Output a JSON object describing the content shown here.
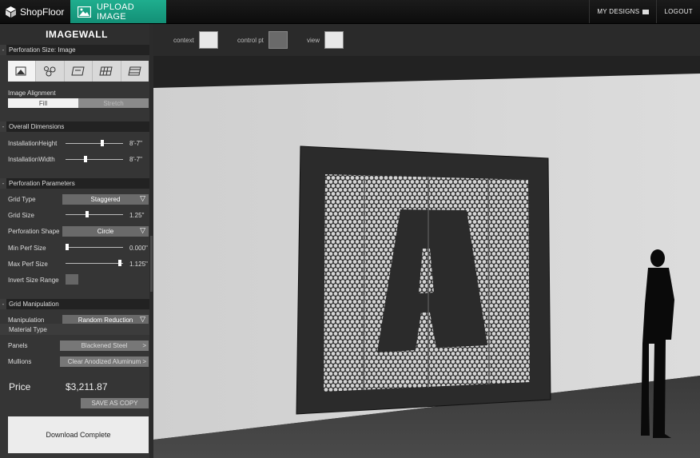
{
  "topbar": {
    "brand": "ShopFloor",
    "upload": "UPLOAD IMAGE",
    "my_designs": "MY DESIGNS",
    "logout": "LOGOUT"
  },
  "panel": {
    "logo": "IMAGEWALL",
    "perforation_size": {
      "title": "Perforation Size: Image",
      "icons": [
        "image-mode-icon",
        "circles-icon",
        "map-icon",
        "grid-map-icon",
        "grid-icon"
      ],
      "alignment_label": "Image Alignment",
      "fill": "Fill",
      "stretch": "Stretch"
    },
    "overall": {
      "title": "Overall Dimensions",
      "height_label": "InstallationHeight",
      "height_value": "8'-7\"",
      "width_label": "InstallationWidth",
      "width_value": "8'-7\""
    },
    "perf_params": {
      "title": "Perforation Parameters",
      "grid_type_label": "Grid Type",
      "grid_type": "Staggered",
      "grid_size_label": "Grid Size",
      "grid_size": "1.25\"",
      "shape_label": "Perforation Shape",
      "shape": "Circle",
      "min_label": "Min Perf Size",
      "min_value": "0.000\"",
      "max_label": "Max Perf Size",
      "max_value": "1.125\"",
      "invert_label": "Invert Size Range"
    },
    "grid_manip": {
      "title": "Grid Manipulation",
      "manip_label": "Manipulation",
      "manip_value": "Random Reduction"
    },
    "material": {
      "title": "Material Type",
      "panels_label": "Panels",
      "panels_value": "Blackened Steel",
      "mullions_label": "Mullions",
      "mullions_value": "Clear Anodized Aluminum"
    },
    "price_label": "Price",
    "price_value": "$3,211.87",
    "save_copy": "SAVE AS COPY",
    "download": "Download Complete"
  },
  "scene": {
    "tools": {
      "context": "context",
      "control_pt": "control pt",
      "view": "view"
    },
    "panel_letter": "A"
  }
}
